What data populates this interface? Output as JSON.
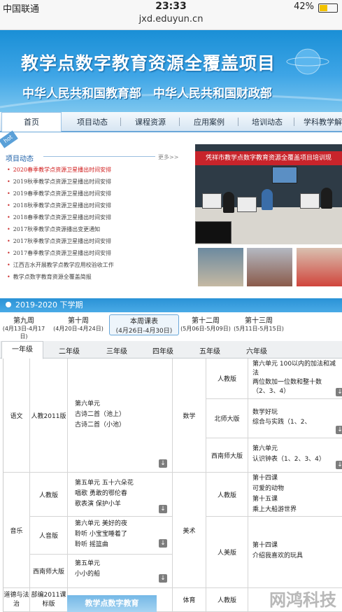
{
  "status": {
    "carrier": "中国联通",
    "time": "23:33",
    "battery": "42%",
    "battery_level": 0.42
  },
  "url": "jxd.eduyun.cn",
  "banner": {
    "title": "教学点数字教育资源全覆盖项目",
    "subtitle": "中华人民共和国教育部　中华人民共和国财政部"
  },
  "nav": [
    "首页",
    "项目动态",
    "课程资源",
    "应用案例",
    "培训动态",
    "学科教学解答"
  ],
  "news": {
    "hot": "hot",
    "header": "项目动态",
    "more": "更多>>",
    "items": [
      "2020春季教学点资源卫星播出时间安排",
      "2019秋季教学点资源卫星播出时间安排",
      "2019春季教学点资源卫星播出时间安排",
      "2018秋季教学点资源卫星播出时间安排",
      "2018春季教学点资源卫星播出时间安排",
      "2017秋季教学点资源播出变更通知",
      "2017秋季教学点资源卫星播出时间安排",
      "2017春季教学点资源卫星播出时间安排",
      "江西吉水开展教学点教学应用校验收工作",
      "教学点数字教育资源全覆盖简报"
    ]
  },
  "photo": {
    "banner_text": "凭祥市教学点数字教育资源全覆盖项目培训现"
  },
  "semester": "2019-2020 下学期",
  "weeks": [
    {
      "label": "第九周",
      "dates": "(4月13日-4月17日)"
    },
    {
      "label": "第十周",
      "dates": "(4月20日-4月24日)"
    },
    {
      "label": "本周课表",
      "dates": "(4月26日-4月30日)"
    },
    {
      "label": "第十二周",
      "dates": "(5月06日-5月09日)"
    },
    {
      "label": "第十三周",
      "dates": "(5月11日-5月15日)"
    }
  ],
  "grades": [
    "一年级",
    "二年级",
    "三年级",
    "四年级",
    "五年级",
    "六年级"
  ],
  "table": {
    "chinese": {
      "subject": "语文",
      "edition": "人教2011版",
      "content": [
        "第六单元",
        "古诗二首（池上）",
        "古诗二首（小池）"
      ]
    },
    "math": {
      "subject": "数学",
      "rows": [
        {
          "edition": "人教版",
          "content": [
            "第六单元 100以内的加法和减",
            "法",
            "两位数加一位数和整十数",
            "（2、3、4）"
          ]
        },
        {
          "edition": "北师大版",
          "content": [
            "数学好玩",
            "综合与实践（1、2、"
          ]
        },
        {
          "edition": "西南师大版",
          "content": [
            "第六单元",
            "认识钟表（1、2、3、4）"
          ]
        }
      ]
    },
    "music": {
      "subject": "音乐",
      "rows": [
        {
          "edition": "人教版",
          "content": [
            "第五单元 五十六朵花",
            "唱歌 勇敢的鄂伦春",
            "歌表演 保护小羊"
          ]
        },
        {
          "edition": "人音版",
          "content": [
            "第六单元 美好的夜",
            "聆听 小宝宝睡着了",
            "聆听 摇篮曲"
          ]
        },
        {
          "edition": "西南师大版",
          "content": [
            "第五单元",
            "小小的船"
          ]
        }
      ]
    },
    "art": {
      "subject": "美术",
      "rows": [
        {
          "edition": "人教版",
          "content": [
            "第十四课",
            "可爱的动物",
            "第十五课",
            "乘上大船游世界"
          ]
        },
        {
          "edition": "人美版",
          "content": [
            "第十四课",
            "介绍我喜欢的玩具"
          ]
        }
      ]
    },
    "ethics": {
      "subject": "道德与法治",
      "edition": "部编2011课标版"
    },
    "pe": {
      "subject": "体育",
      "edition": "人教版"
    },
    "download": "↓"
  },
  "promo": "教学点数字教育",
  "watermark": "网鸿科技",
  "colors": {
    "primary": "#2a92d6",
    "red": "#d01c1c",
    "nav_border": "#6aa7d9"
  }
}
